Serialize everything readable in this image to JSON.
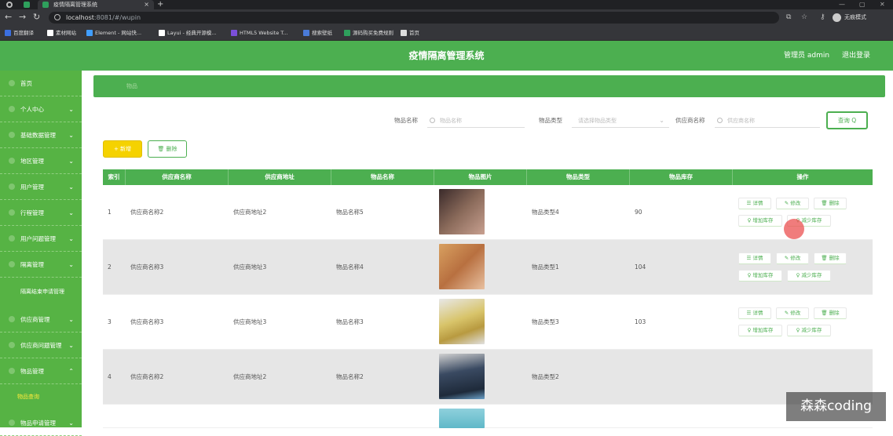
{
  "browser": {
    "tab_title": "疫情隔离管理系统",
    "tab_close": "×",
    "new_tab": "+",
    "url_host": "localhost",
    "url_rest": ":8081/#/wupin",
    "incognito": "无痕模式",
    "bookmarks": [
      {
        "label": "百度翻译",
        "color": "#3b6fe0"
      },
      {
        "label": "素材网站",
        "color": "#ffffff"
      },
      {
        "label": "Element - 网站快...",
        "color": "#409eff"
      },
      {
        "label": "Layui - 经典开源模...",
        "color": "#ffffff"
      },
      {
        "label": "HTML5 Website T...",
        "color": "#7b4fd8"
      },
      {
        "label": "搜索壁纸",
        "color": "#4a7bd8"
      },
      {
        "label": "源码购买免费规则",
        "color": "#2ea05c"
      },
      {
        "label": "首页",
        "color": "#dddddd"
      }
    ]
  },
  "header": {
    "title": "疫情隔离管理系统",
    "user": "管理员 admin",
    "logout": "退出登录"
  },
  "sidebar": {
    "items": [
      {
        "label": "首页"
      },
      {
        "label": "个人中心",
        "chevron": "⌄"
      },
      {
        "label": "基础数据管理",
        "chevron": "⌄"
      },
      {
        "label": "地区管理",
        "chevron": "⌄"
      },
      {
        "label": "用户管理",
        "chevron": "⌄"
      },
      {
        "label": "行程管理",
        "chevron": "⌄"
      },
      {
        "label": "用户问题管理",
        "chevron": "⌄"
      },
      {
        "label": "隔离管理",
        "chevron": "⌄"
      },
      {
        "label": "隔离结束申请管理"
      },
      {
        "label": "供应商管理",
        "chevron": "⌄"
      },
      {
        "label": "供应商问题管理",
        "chevron": "⌄"
      },
      {
        "label": "物品管理",
        "chevron": "⌃"
      },
      {
        "label": "物品查询"
      },
      {
        "label": "物品申请管理",
        "chevron": "⌄"
      }
    ]
  },
  "breadcrumb": "物品",
  "search": {
    "name_label": "物品名称",
    "name_placeholder": "物品名称",
    "type_label": "物品类型",
    "type_placeholder": "请选择物品类型",
    "supplier_label": "供应商名称",
    "supplier_placeholder": "供应商名称",
    "query_button": "查询 Q"
  },
  "actions": {
    "add": "+ 新增",
    "delete": "🗑 删除"
  },
  "table": {
    "headers": [
      "索引",
      "供应商名称",
      "供应商地址",
      "物品名称",
      "物品图片",
      "物品类型",
      "物品库存",
      "操作"
    ],
    "ops": {
      "detail": "☰ 详情",
      "edit": "✎ 修改",
      "delete": "🗑 删除",
      "add_stock": "♀ 增加库存",
      "reduce_stock": "♀ 减少库存"
    },
    "rows": [
      {
        "index": "1",
        "supplier": "供应商名称2",
        "address": "供应商地址2",
        "name": "物品名称5",
        "type": "物品类型4",
        "stock": "90",
        "img": "#6b4a3a"
      },
      {
        "index": "2",
        "supplier": "供应商名称3",
        "address": "供应商地址3",
        "name": "物品名称4",
        "type": "物品类型1",
        "stock": "104",
        "img": "#c98b4a"
      },
      {
        "index": "3",
        "supplier": "供应商名称3",
        "address": "供应商地址3",
        "name": "物品名称3",
        "type": "物品类型3",
        "stock": "103",
        "img": "#d8c46a"
      },
      {
        "index": "4",
        "supplier": "供应商名称2",
        "address": "供应商地址2",
        "name": "物品名称2",
        "type": "物品类型2",
        "stock": "",
        "img": "#3a4a62"
      },
      {
        "index": "",
        "supplier": "",
        "address": "",
        "name": "",
        "type": "",
        "stock": "",
        "img": "#5fb8c8"
      }
    ]
  },
  "watermark": "森森coding"
}
